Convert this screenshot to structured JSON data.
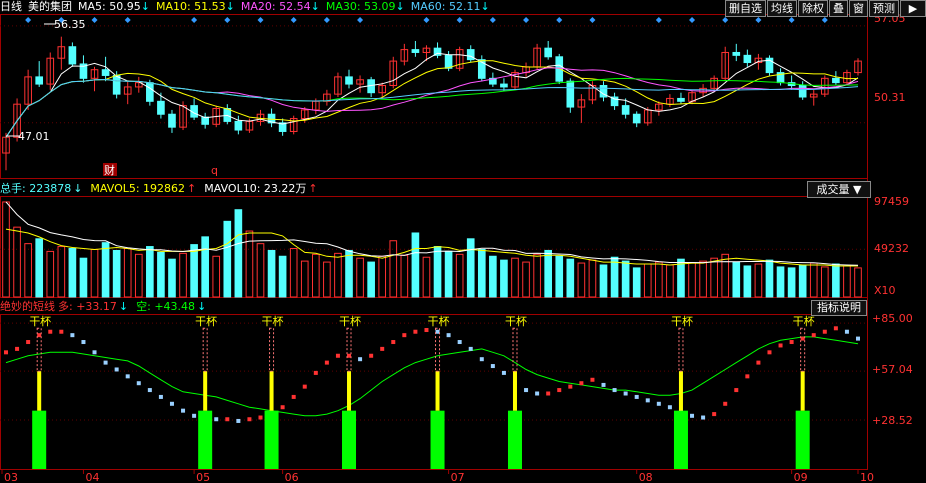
{
  "header": {
    "period": "日线",
    "stock_name": "美的集团",
    "ma5": {
      "label": "MA5:",
      "value": "50.95",
      "arrow": "↓",
      "color": "#ffffff"
    },
    "ma10": {
      "label": "MA10:",
      "value": "51.53",
      "arrow": "↓",
      "color": "#ffff00"
    },
    "ma20": {
      "label": "MA20:",
      "value": "52.54",
      "arrow": "↓",
      "color": "#ff55ff"
    },
    "ma30": {
      "label": "MA30:",
      "value": "53.09",
      "arrow": "↓",
      "color": "#00ff00"
    },
    "ma60": {
      "label": "MA60:",
      "value": "52.11",
      "arrow": "↓",
      "color": "#55ccff"
    }
  },
  "toolbar": {
    "buttons": [
      "删自选",
      "均线",
      "除权",
      "叠",
      "窗",
      "预测"
    ],
    "arrow": "▶"
  },
  "price_axis": [
    "57.05",
    "50.31"
  ],
  "price_annotations": {
    "high": "56.35",
    "low": "47.01",
    "event1": "财",
    "event2": "q"
  },
  "volume_header": {
    "total": "总手: 223878",
    "total_arrow": "↓",
    "mavol5": "MAVOL5: 192862",
    "mavol5_arrow": "↑",
    "mavol10": "MAVOL10: 23.22万",
    "mavol10_arrow": "↑"
  },
  "volume_select": "成交量",
  "volume_axis": [
    "97459",
    "49232",
    "X10"
  ],
  "indicator_header": {
    "name": "绝妙的短线",
    "long": "多: +33.17",
    "long_arrow": "↓",
    "short": "空: +43.48",
    "short_arrow": "↓"
  },
  "indicator_button": "指标说明",
  "indicator_axis": [
    "+85.00",
    "+57.04",
    "+28.52"
  ],
  "signal_label": "干杯",
  "month_labels": [
    "03",
    "04",
    "05",
    "06",
    "07",
    "08",
    "09",
    "10"
  ],
  "colors": {
    "up": "#ff3232",
    "down": "#54ffff",
    "grid": "#a00000",
    "signal": "#00ff00"
  },
  "chart_data": {
    "type": "candlestick",
    "ohlc": [
      [
        48.2,
        49.6,
        47.0,
        49.3
      ],
      [
        49.3,
        52.0,
        49.0,
        51.6
      ],
      [
        51.6,
        54.0,
        51.2,
        53.5
      ],
      [
        53.5,
        54.6,
        52.8,
        53.0
      ],
      [
        53.0,
        55.2,
        52.6,
        54.8
      ],
      [
        54.8,
        56.3,
        54.0,
        55.6
      ],
      [
        55.6,
        55.9,
        54.2,
        54.4
      ],
      [
        54.4,
        55.0,
        53.1,
        53.4
      ],
      [
        53.4,
        54.2,
        52.5,
        54.0
      ],
      [
        54.0,
        54.9,
        53.2,
        53.6
      ],
      [
        53.6,
        53.9,
        52.0,
        52.3
      ],
      [
        52.3,
        53.2,
        51.6,
        52.8
      ],
      [
        52.8,
        53.5,
        52.4,
        53.1
      ],
      [
        53.1,
        53.3,
        51.5,
        51.8
      ],
      [
        51.8,
        52.4,
        50.6,
        50.9
      ],
      [
        50.9,
        51.2,
        49.6,
        50.0
      ],
      [
        50.0,
        51.8,
        49.8,
        51.5
      ],
      [
        51.5,
        52.0,
        50.5,
        50.7
      ],
      [
        50.7,
        51.0,
        49.9,
        50.2
      ],
      [
        50.2,
        51.5,
        50.0,
        51.3
      ],
      [
        51.3,
        51.6,
        50.2,
        50.4
      ],
      [
        50.4,
        50.8,
        49.5,
        49.8
      ],
      [
        49.8,
        50.6,
        49.6,
        50.4
      ],
      [
        50.4,
        51.2,
        50.1,
        50.9
      ],
      [
        50.9,
        51.3,
        50.0,
        50.3
      ],
      [
        50.3,
        50.6,
        49.4,
        49.7
      ],
      [
        49.7,
        50.8,
        49.5,
        50.6
      ],
      [
        50.6,
        51.4,
        50.3,
        51.2
      ],
      [
        51.2,
        52.0,
        50.9,
        51.8
      ],
      [
        51.8,
        52.6,
        51.5,
        52.3
      ],
      [
        52.3,
        53.8,
        52.1,
        53.5
      ],
      [
        53.5,
        54.0,
        52.7,
        53.0
      ],
      [
        53.0,
        53.6,
        52.4,
        53.3
      ],
      [
        53.3,
        53.5,
        52.1,
        52.4
      ],
      [
        52.4,
        53.1,
        52.0,
        52.9
      ],
      [
        52.9,
        54.9,
        52.7,
        54.6
      ],
      [
        54.6,
        55.8,
        54.3,
        55.4
      ],
      [
        55.4,
        56.0,
        54.9,
        55.2
      ],
      [
        55.2,
        55.7,
        54.6,
        55.5
      ],
      [
        55.5,
        55.9,
        54.8,
        55.0
      ],
      [
        55.0,
        55.3,
        53.9,
        54.1
      ],
      [
        54.1,
        55.6,
        53.9,
        55.4
      ],
      [
        55.4,
        55.7,
        54.5,
        54.7
      ],
      [
        54.7,
        55.0,
        53.2,
        53.4
      ],
      [
        53.4,
        53.8,
        52.8,
        53.0
      ],
      [
        53.0,
        53.4,
        52.5,
        52.8
      ],
      [
        52.8,
        54.0,
        52.6,
        53.8
      ],
      [
        53.8,
        54.5,
        53.5,
        54.2
      ],
      [
        54.2,
        55.8,
        54.0,
        55.5
      ],
      [
        55.5,
        56.0,
        54.7,
        54.9
      ],
      [
        54.9,
        55.1,
        53.0,
        53.2
      ],
      [
        53.2,
        53.4,
        51.0,
        51.4
      ],
      [
        51.4,
        52.3,
        50.3,
        51.9
      ],
      [
        51.9,
        53.2,
        51.6,
        52.9
      ],
      [
        52.9,
        53.2,
        51.8,
        52.1
      ],
      [
        52.1,
        52.4,
        51.2,
        51.5
      ],
      [
        51.5,
        52.0,
        50.6,
        50.9
      ],
      [
        50.9,
        51.1,
        50.0,
        50.3
      ],
      [
        50.3,
        51.4,
        50.1,
        51.2
      ],
      [
        51.2,
        51.8,
        50.8,
        51.6
      ],
      [
        51.6,
        52.3,
        51.4,
        52.0
      ],
      [
        52.0,
        52.4,
        51.6,
        51.8
      ],
      [
        51.8,
        52.6,
        51.6,
        52.4
      ],
      [
        52.4,
        53.0,
        52.1,
        52.7
      ],
      [
        52.7,
        53.6,
        52.5,
        53.4
      ],
      [
        53.4,
        55.6,
        53.2,
        55.2
      ],
      [
        55.2,
        55.8,
        54.6,
        55.0
      ],
      [
        55.0,
        55.4,
        54.2,
        54.5
      ],
      [
        54.5,
        55.1,
        54.0,
        54.8
      ],
      [
        54.8,
        55.0,
        53.6,
        53.8
      ],
      [
        53.8,
        54.1,
        52.9,
        53.1
      ],
      [
        53.1,
        53.6,
        52.6,
        52.9
      ],
      [
        52.9,
        53.2,
        51.9,
        52.1
      ],
      [
        52.1,
        52.6,
        51.5,
        52.3
      ],
      [
        52.3,
        53.6,
        52.1,
        53.4
      ],
      [
        53.4,
        53.9,
        52.9,
        53.1
      ],
      [
        53.1,
        54.0,
        52.9,
        53.8
      ],
      [
        53.8,
        54.8,
        53.6,
        54.6
      ]
    ],
    "volume": [
      98,
      72,
      55,
      60,
      47,
      52,
      50,
      40,
      49,
      56,
      48,
      50,
      44,
      52,
      46,
      39,
      45,
      54,
      62,
      42,
      78,
      90,
      68,
      55,
      48,
      42,
      50,
      37,
      44,
      36,
      45,
      48,
      40,
      36,
      42,
      58,
      43,
      66,
      41,
      52,
      47,
      44,
      60,
      49,
      42,
      38,
      40,
      36,
      44,
      48,
      42,
      39,
      35,
      38,
      33,
      41,
      37,
      30,
      34,
      36,
      33,
      39,
      35,
      37,
      40,
      44,
      36,
      32,
      34,
      38,
      31,
      30,
      33,
      35,
      31,
      34,
      32,
      30
    ],
    "mavol5": [
      70,
      68,
      66,
      62,
      57,
      53,
      51,
      50,
      49,
      50,
      51,
      50,
      48,
      49,
      47,
      47,
      47,
      47,
      49,
      50,
      55,
      64,
      66,
      66,
      66,
      63,
      54,
      46,
      45,
      42,
      41,
      43,
      43,
      42,
      40,
      43,
      46,
      50,
      50,
      52,
      51,
      48,
      49,
      48,
      47,
      46,
      45,
      43,
      42,
      43,
      43,
      42,
      40,
      38,
      36,
      36,
      35,
      34,
      34,
      34,
      33,
      34,
      35,
      35,
      37,
      39,
      40,
      39,
      38,
      37,
      35,
      34,
      33,
      33,
      33,
      32,
      32,
      32
    ],
    "indicator": {
      "line": [
        62,
        64,
        66,
        67,
        68,
        68,
        68,
        67,
        66,
        65,
        64,
        63,
        60,
        56,
        52,
        48,
        45,
        44,
        43,
        42,
        40,
        38,
        36,
        35,
        34,
        33,
        32,
        31,
        31,
        32,
        34,
        37,
        41,
        46,
        51,
        55,
        59,
        62,
        64,
        66,
        67,
        68,
        69,
        70,
        68,
        66,
        62,
        58,
        55,
        53,
        51,
        50,
        49,
        48,
        47,
        46,
        46,
        45,
        44,
        43,
        43,
        44,
        46,
        50,
        54,
        58,
        62,
        66,
        70,
        73,
        75,
        76,
        77,
        77,
        76,
        75,
        74,
        73
      ],
      "dots": [
        68,
        70,
        74,
        78,
        80,
        80,
        78,
        74,
        68,
        62,
        58,
        54,
        50,
        46,
        42,
        38,
        34,
        31,
        30,
        29,
        29,
        28,
        29,
        30,
        32,
        36,
        42,
        48,
        56,
        62,
        66,
        66,
        64,
        66,
        70,
        74,
        78,
        80,
        81,
        80,
        78,
        74,
        70,
        64,
        60,
        56,
        50,
        46,
        44,
        44,
        46,
        48,
        50,
        52,
        49,
        46,
        44,
        42,
        40,
        38,
        36,
        33,
        31,
        30,
        32,
        38,
        46,
        54,
        62,
        68,
        72,
        74,
        76,
        78,
        80,
        82,
        80,
        76
      ],
      "signals": [
        3,
        18,
        24,
        31,
        39,
        46,
        61,
        72
      ]
    }
  }
}
